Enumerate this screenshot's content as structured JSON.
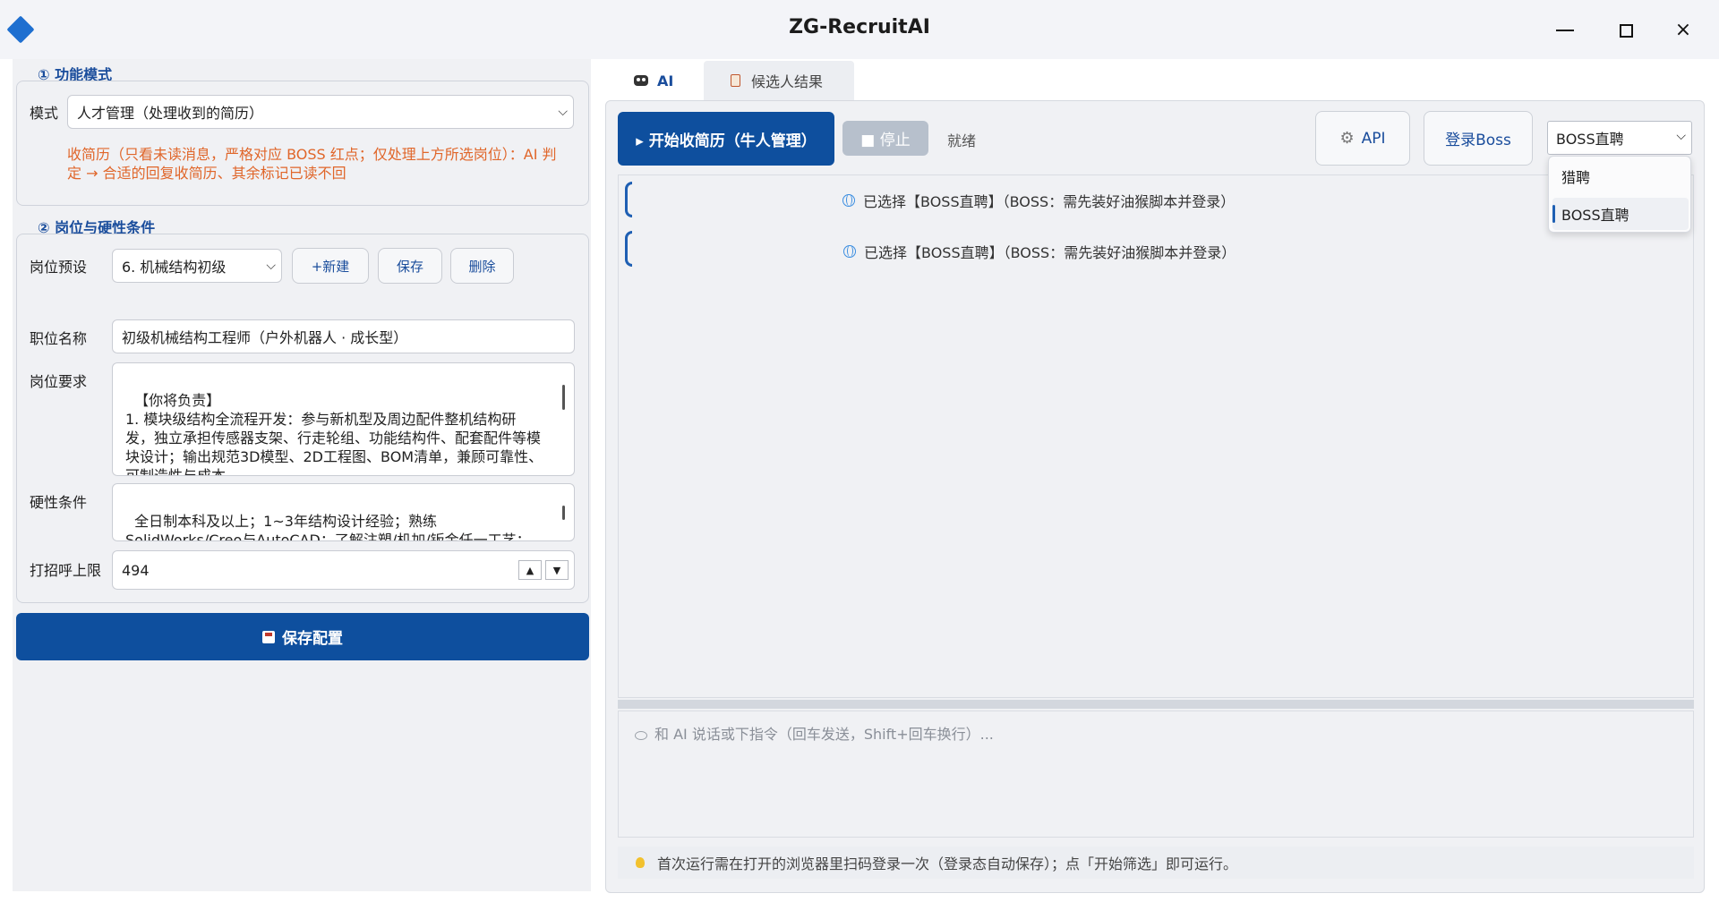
{
  "window": {
    "title": "ZG-RecruitAI",
    "controls": [
      "minimize",
      "maximize",
      "close"
    ],
    "close_glyph": "×"
  },
  "colors": {
    "primary": "#0e4f9e",
    "accent_text": "#1a4d9c",
    "warning_text": "#e0662a",
    "disabled_button": "#b7c0cc"
  },
  "left": {
    "section1": {
      "title": "① 功能模式",
      "mode_label": "模式",
      "mode_value": "人才管理（处理收到的简历）",
      "note": "收简历（只看未读消息，严格对应 BOSS 红点；仅处理上方所选岗位）：AI 判定 → 合适的回复收简历、其余标记已读不回"
    },
    "section2": {
      "title": "② 岗位与硬性条件",
      "preset_label": "岗位预设",
      "preset_value": "6. 机械结构初级",
      "btn_new": "+新建",
      "btn_save_preset": "保存",
      "btn_delete": "删除",
      "job_title_label": "职位名称",
      "job_title_value": "初级机械结构工程师（户外机器人 · 成长型）",
      "requirements_label": "岗位要求",
      "requirements_value": "【你将负责】\n1. 模块级结构全流程开发：参与新机型及周边配件整机结构研发，独立承担传感器支架、行走轮组、功能结构件、配套配件等模块设计；输出规范3D模型、2D工程图、BOM清单，兼顾可靠性、可制造性与成本。",
      "hard_label": "硬性条件",
      "hard_value": "全日制本科及以上；1~3年结构设计经验；熟练SolidWorks/Creo与AutoCAD；了解注塑/机加/钣金任一工艺；",
      "greet_limit_label": "打招呼上限",
      "greet_limit_value": "494"
    },
    "save_button": "保存配置"
  },
  "right": {
    "tabs": [
      {
        "label": "AI",
        "active": true,
        "icon": "robot-icon"
      },
      {
        "label": "候选人结果",
        "active": false,
        "icon": "clipboard-icon"
      }
    ],
    "toolbar": {
      "start_button": "▸ 开始收简历（牛人管理）",
      "stop_button": "■ 停止",
      "status": "就绪",
      "api_button": "API",
      "login_button": "登录Boss",
      "platform_selected": "BOSS直聘"
    },
    "dropdown_options": [
      "猎聘",
      "BOSS直聘"
    ],
    "log_messages": [
      "已选择【BOSS直聘】（BOSS：需先装好油猴脚本并登录）",
      "已选择【BOSS直聘】（BOSS：需先装好油猴脚本并登录）"
    ],
    "chat_placeholder": "和 AI 说话或下指令（回车发送，Shift+回车换行）...",
    "footer_hint": "首次运行需在打开的浏览器里扫码登录一次（登录态自动保存）；点「开始筛选」即可运行。"
  }
}
